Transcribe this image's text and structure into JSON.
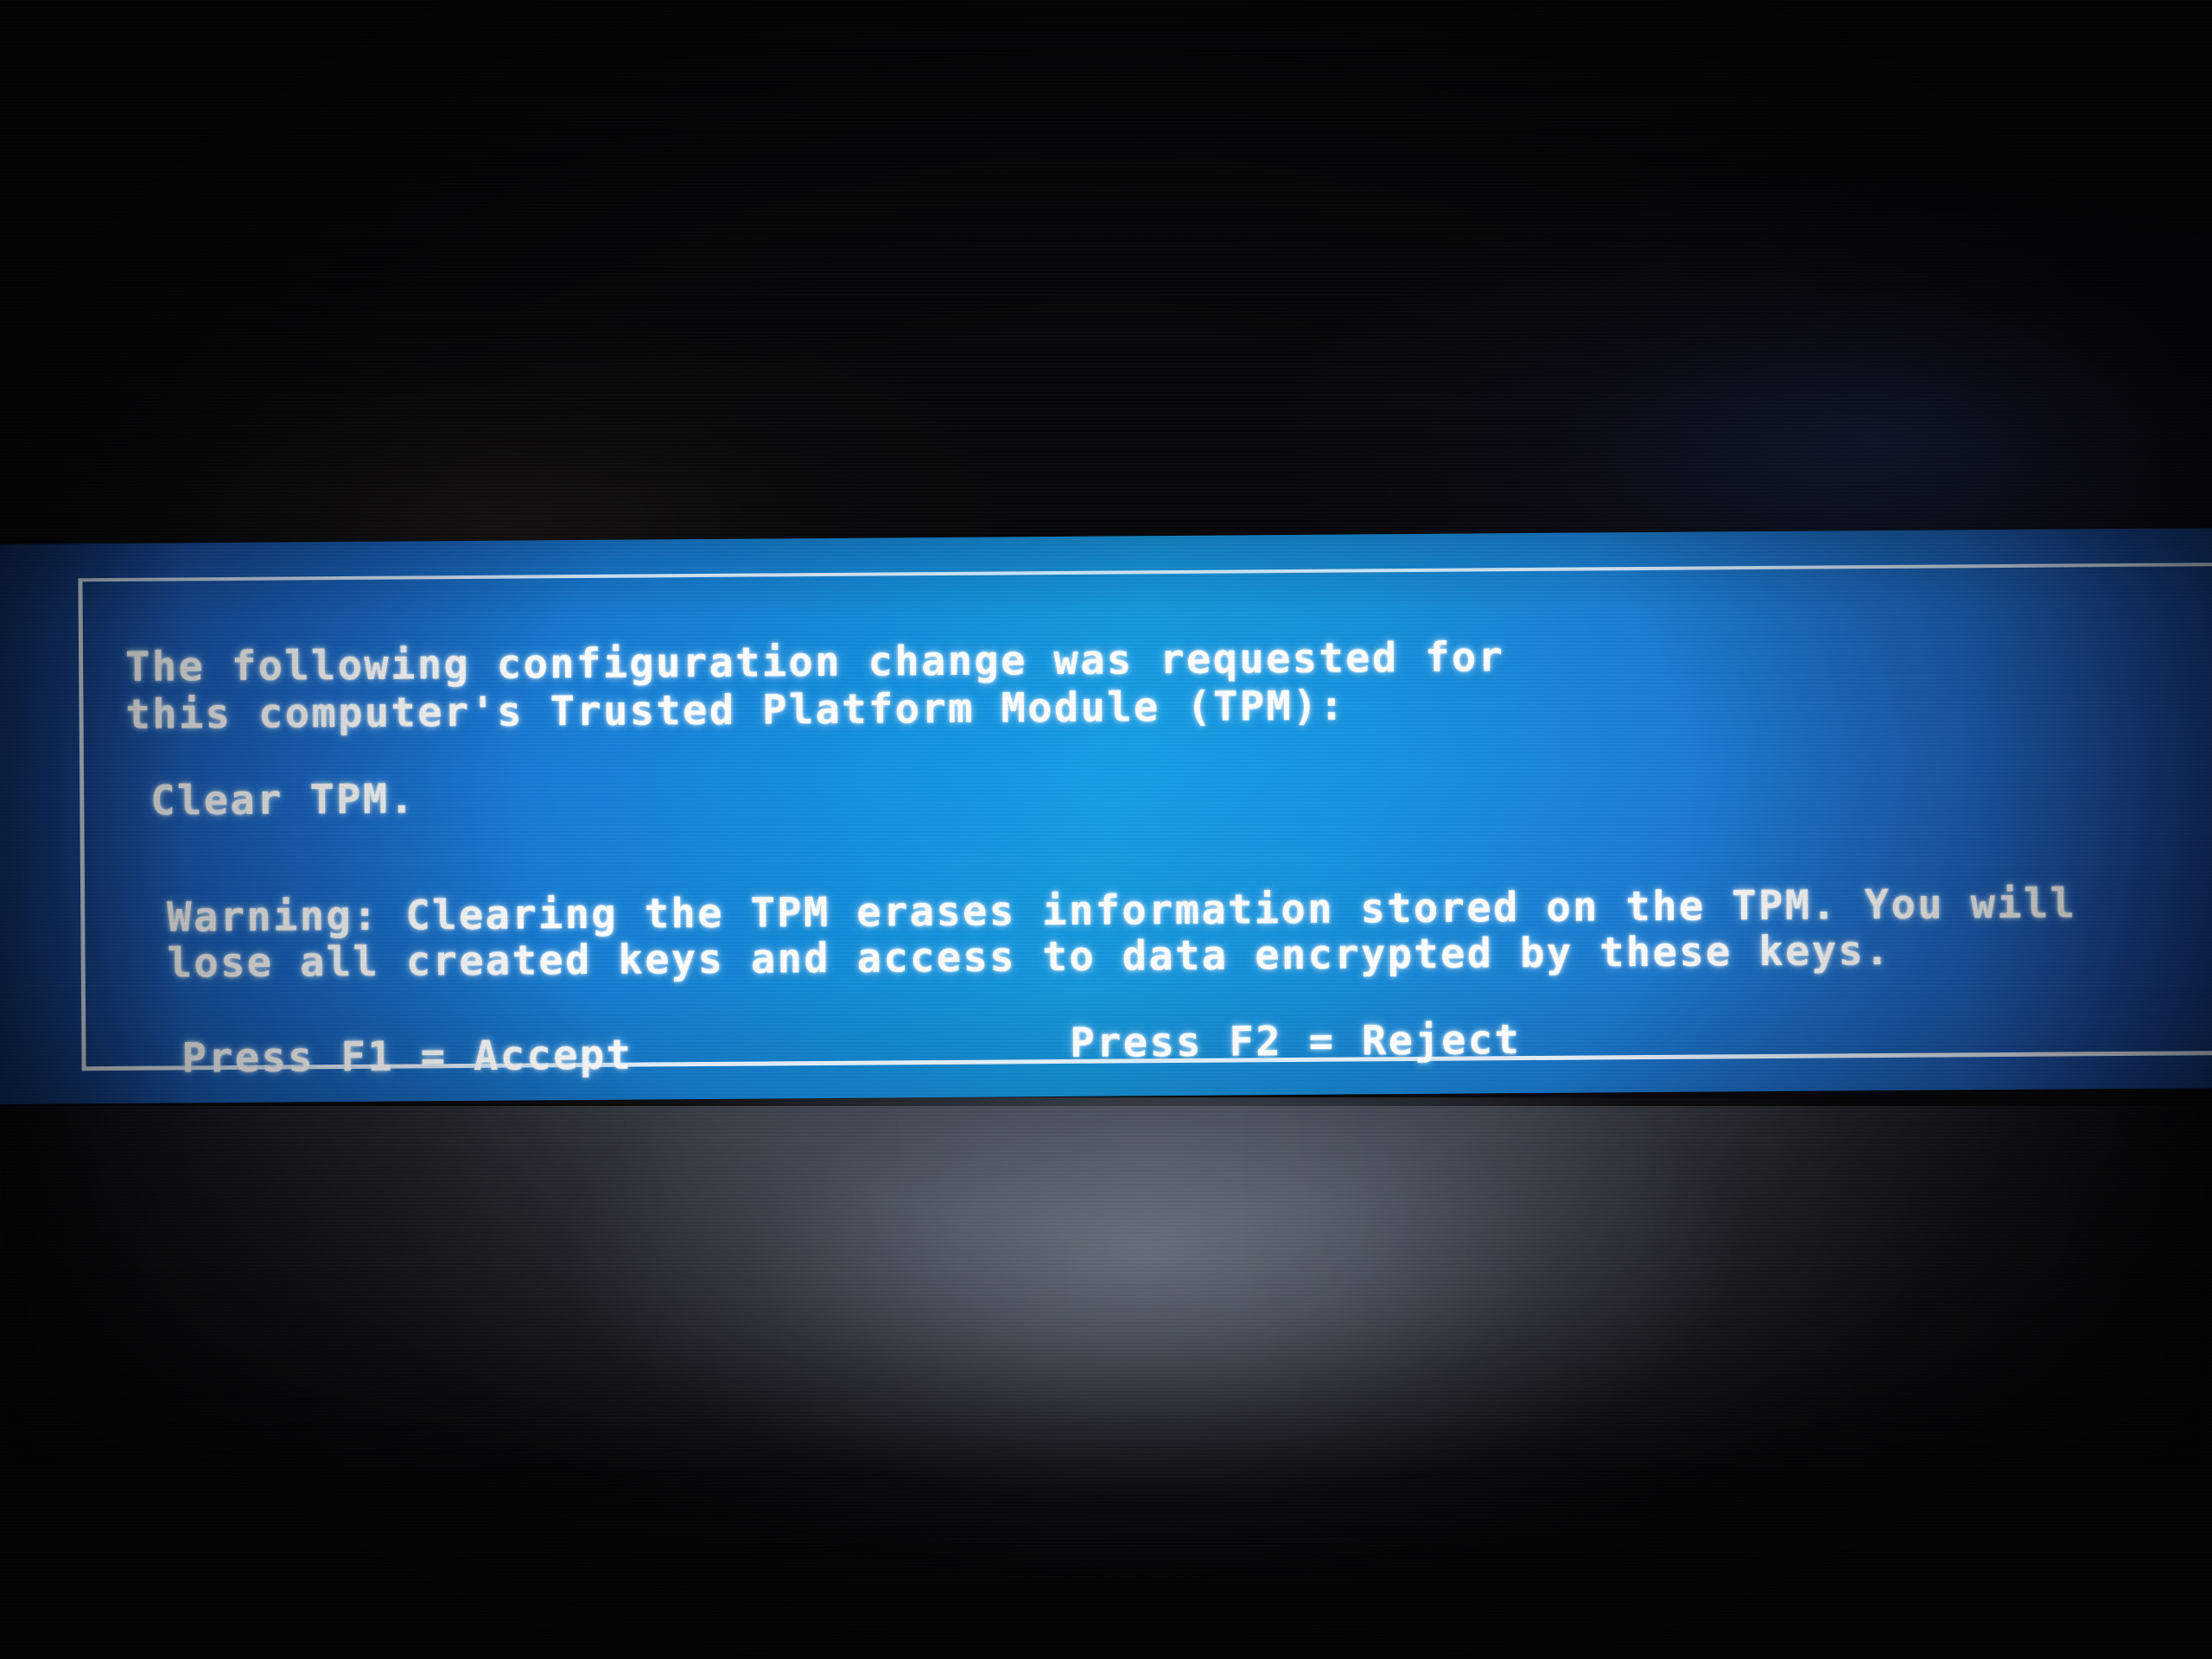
{
  "screen": {
    "kind": "bios-tpm-configuration-change-prompt",
    "background_color": "#070709",
    "lower_panel_color": "#6a707c"
  },
  "dialog": {
    "background_color_left": "#1b50ab",
    "background_color_center": "#169fe6",
    "background_color_right": "#1d4fae",
    "border_color": "#eef4fc",
    "text_color": "#ffffff",
    "message_lines": {
      "line1": "The following configuration change was requested for",
      "line2": "this computer's Trusted Platform Module (TPM):",
      "change": "Clear TPM.",
      "warning1": "Warning: Clearing the TPM erases information stored on the TPM. You will",
      "warning2": "lose all created keys and access to data encrypted by these keys."
    },
    "actions": {
      "accept": "Press F1 = Accept",
      "reject": "Press F2 = Reject"
    }
  }
}
